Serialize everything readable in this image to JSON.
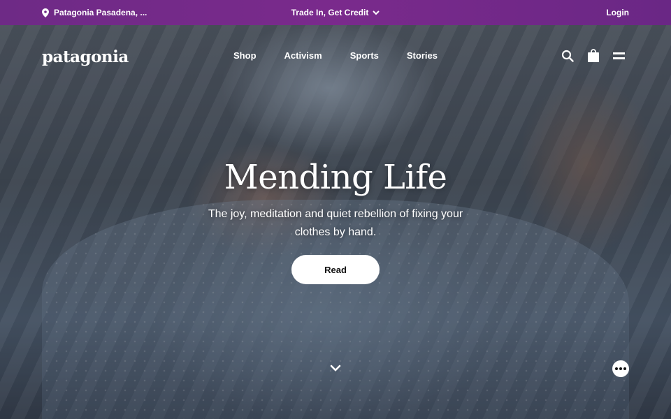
{
  "topbar": {
    "location": "Patagonia Pasadena, ...",
    "promo": "Trade In, Get Credit",
    "login": "Login",
    "icons": [
      "location-pin-icon",
      "chevron-down-icon"
    ]
  },
  "nav": {
    "logo": "patagonia",
    "links": [
      "Shop",
      "Activism",
      "Sports",
      "Stories"
    ],
    "icons": [
      "search-icon",
      "bag-icon",
      "menu-icon"
    ]
  },
  "hero": {
    "title": "Mending Life",
    "subtitle": "The joy, meditation and quiet rebellion of fixing your clothes by hand.",
    "cta": "Read",
    "icons": [
      "scroll-down-chevron-icon",
      "more-dots-icon"
    ]
  },
  "colors": {
    "topbar": "#722a88",
    "button_bg": "#ffffff",
    "text": "#ffffff"
  }
}
